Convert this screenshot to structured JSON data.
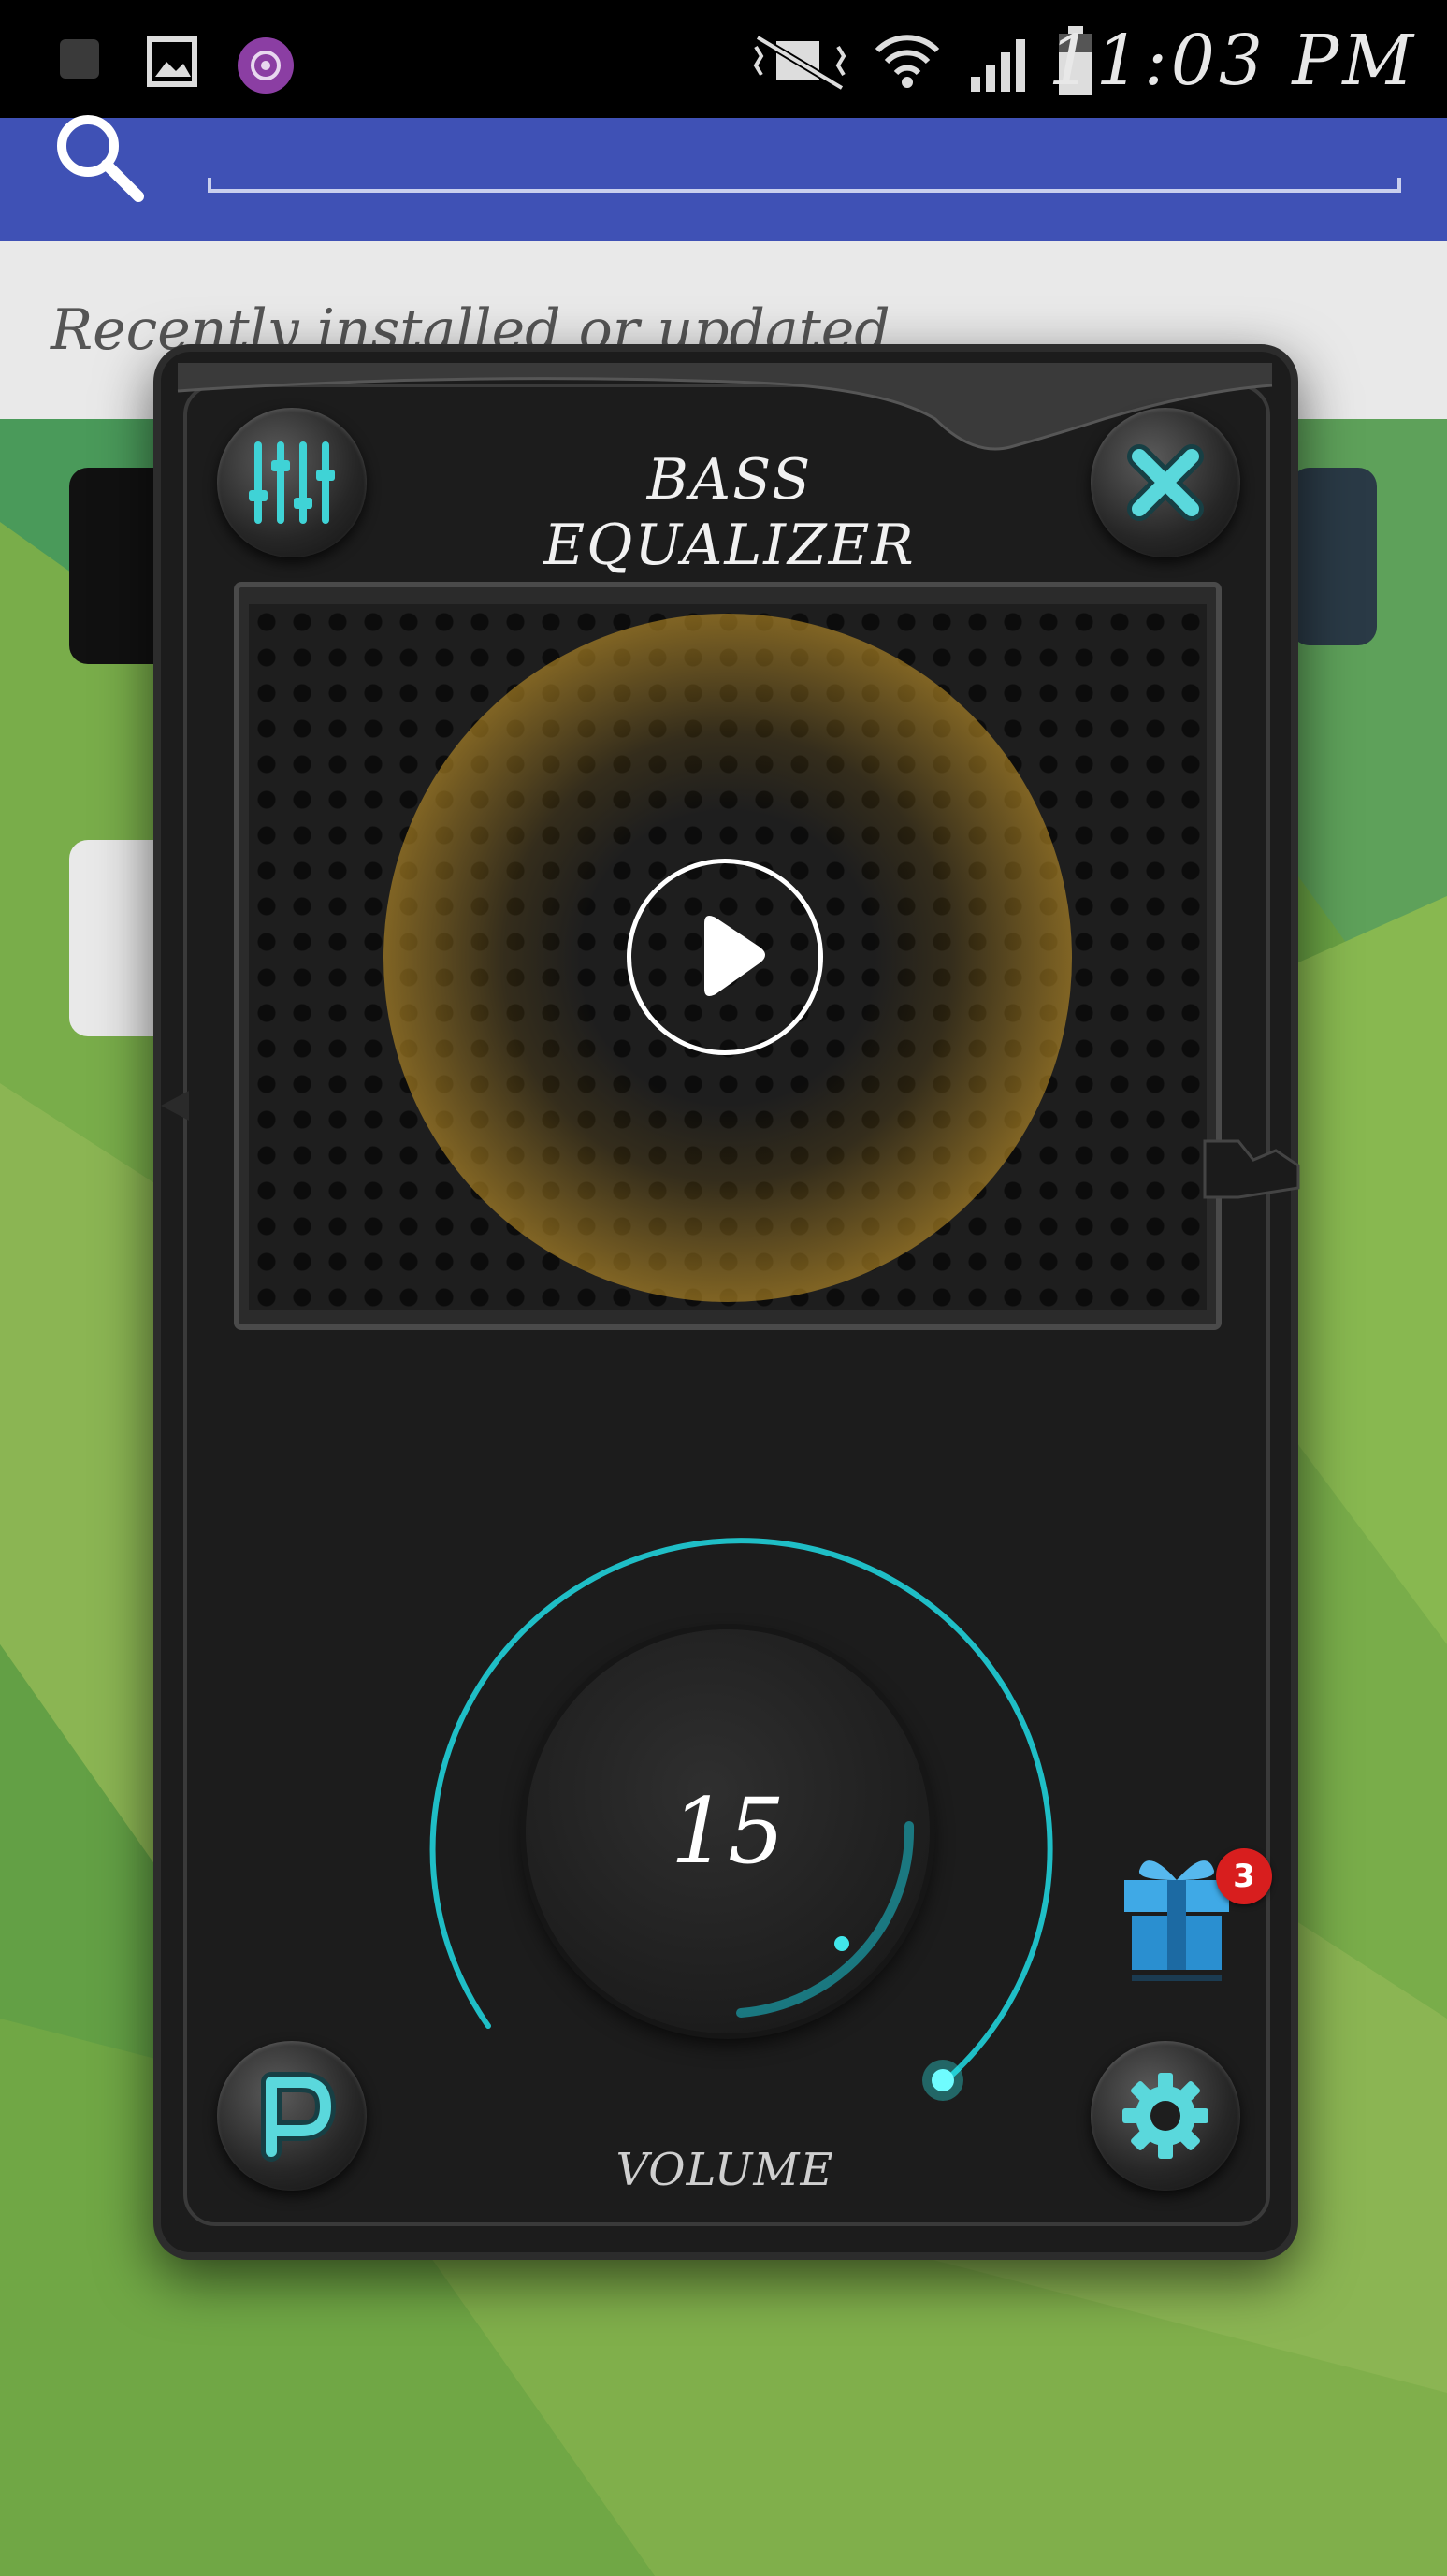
{
  "status_bar": {
    "time": "11:03 PM",
    "icons": [
      "notification-icon",
      "image-icon",
      "music-disc-icon",
      "vibrate-mute-icon",
      "wifi-icon",
      "signal-icon",
      "battery-icon"
    ]
  },
  "search": {
    "placeholder": ""
  },
  "launcher": {
    "recent_label": "Recently installed or updated"
  },
  "equalizer": {
    "title": "BASS EQUALIZER",
    "volume_value": "15",
    "volume_label": "VOLUME",
    "volume_level": 15,
    "gift_badge_count": "3",
    "accent_color": "#27d3d6",
    "glow_color": "#e2a935"
  }
}
